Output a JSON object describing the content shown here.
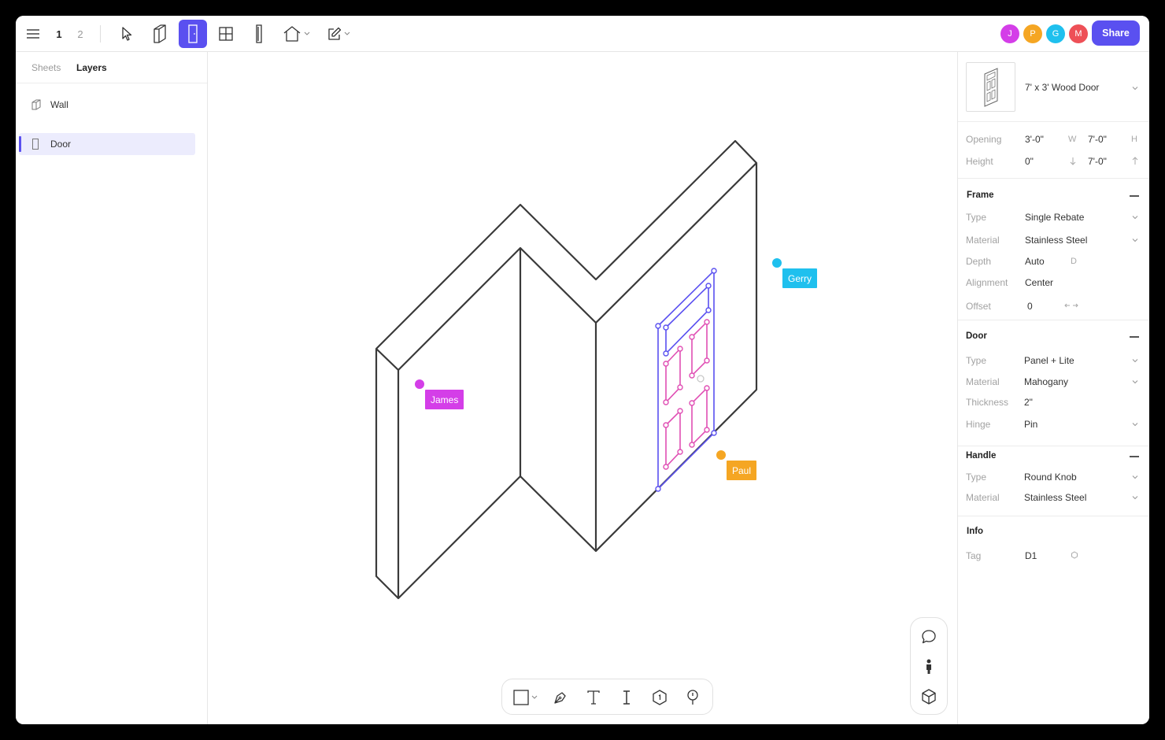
{
  "toolbar": {
    "pages": [
      "1",
      "2"
    ],
    "share_label": "Share",
    "icons": [
      "menu-icon",
      "cursor-icon",
      "wall-icon",
      "door-icon",
      "window-icon",
      "column-icon",
      "house-icon",
      "edit-icon"
    ],
    "accent": "#5a50f0"
  },
  "collaborators": [
    {
      "initial": "J",
      "color": "#d43ee8"
    },
    {
      "initial": "P",
      "color": "#f5a623"
    },
    {
      "initial": "G",
      "color": "#1fc0ee"
    },
    {
      "initial": "M",
      "color": "#ee5057"
    }
  ],
  "left_panel": {
    "tabs": [
      "Sheets",
      "Layers"
    ],
    "active_tab": "Layers",
    "layers": [
      {
        "name": "Wall",
        "icon": "wall-icon",
        "selected": false
      },
      {
        "name": "Door",
        "icon": "door-icon",
        "selected": true
      }
    ]
  },
  "canvas": {
    "cursors": [
      {
        "name": "James",
        "color": "#d43ee8"
      },
      {
        "name": "Gerry",
        "color": "#1fc0ee"
      },
      {
        "name": "Paul",
        "color": "#f5a623"
      }
    ],
    "colors": {
      "wall": "#3a3a3a",
      "door_frame": "#5a50f0",
      "door_panel": "#e04fb4"
    }
  },
  "bottom_tools": [
    "rectangle-icon",
    "pen-icon",
    "text-icon",
    "text-cursor-icon",
    "tag-icon",
    "pin-icon"
  ],
  "side_tools": [
    "comment-icon",
    "person-icon",
    "cube-icon"
  ],
  "inspector": {
    "title": "7' x 3' Wood Door",
    "opening": {
      "opening_label": "Opening",
      "width": "3'-0\"",
      "width_unit": "W",
      "height": "7'-0\"",
      "height_unit": "H",
      "height_label": "Height",
      "sill": "0\"",
      "head": "7'-0\""
    },
    "frame": {
      "title": "Frame",
      "rows": [
        {
          "label": "Type",
          "value": "Single Rebate"
        },
        {
          "label": "Material",
          "value": "Stainless Steel"
        },
        {
          "label": "Depth",
          "value": "Auto",
          "unit": "D"
        },
        {
          "label": "Alignment",
          "value": "Center"
        },
        {
          "label": "Offset",
          "value": "0"
        }
      ]
    },
    "door": {
      "title": "Door",
      "rows": [
        {
          "label": "Type",
          "value": "Panel + Lite"
        },
        {
          "label": "Material",
          "value": "Mahogany"
        },
        {
          "label": "Thickness",
          "value": "2\""
        },
        {
          "label": "Hinge",
          "value": "Pin"
        }
      ]
    },
    "handle": {
      "title": "Handle",
      "rows": [
        {
          "label": "Type",
          "value": "Round Knob"
        },
        {
          "label": "Material",
          "value": "Stainless Steel"
        }
      ]
    },
    "info": {
      "title": "Info",
      "rows": [
        {
          "label": "Tag",
          "value": "D1"
        }
      ]
    }
  }
}
